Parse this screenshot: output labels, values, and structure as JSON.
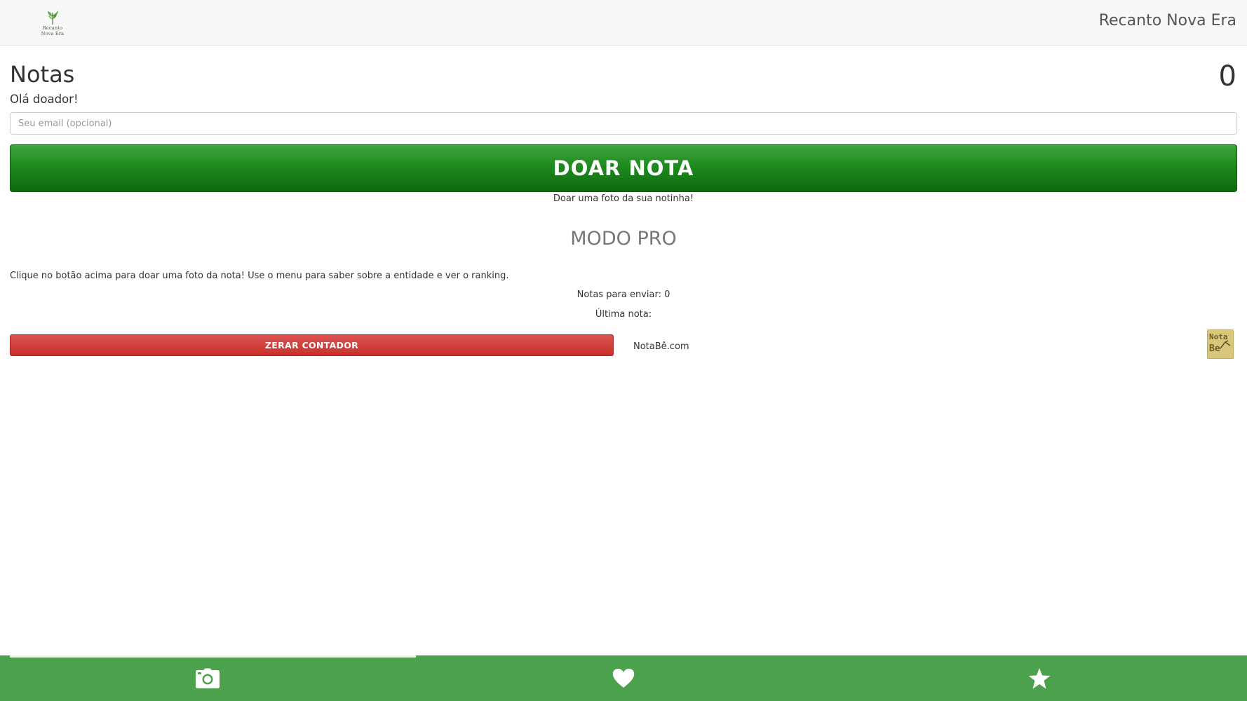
{
  "header": {
    "logo_lines": [
      "Recanto",
      "Nova Era"
    ],
    "brand": "Recanto Nova Era"
  },
  "main": {
    "title": "Notas",
    "counter": "0",
    "greeting": "Olá doador!",
    "email_placeholder": "Seu email (opcional)",
    "email_value": "",
    "donate_button": "DOAR NOTA",
    "donate_hint": "Doar uma foto da sua notinha!",
    "pro_mode": "MODO PRO",
    "instructions": "Clique no botão acima para doar uma foto da nota! Use o menu para saber sobre a entidade e ver o ranking.",
    "pending_notes": "Notas para enviar: 0",
    "last_note": "Última nota:",
    "reset_button": "ZERAR CONTADOR",
    "notabe_link": "NotaBê.com",
    "notabe_logo_lines": [
      "Nota",
      "Be"
    ]
  },
  "bottom_nav": {
    "items": [
      {
        "icon": "camera-icon",
        "active": true
      },
      {
        "icon": "heart-icon",
        "active": false
      },
      {
        "icon": "star-icon",
        "active": false
      }
    ]
  },
  "colors": {
    "header_bg": "#f8f8f8",
    "donate_green": "#1f8a1f",
    "reset_red": "#c9302c",
    "nav_green": "#4ca14c",
    "notabe_gold": "#d8c77a"
  }
}
